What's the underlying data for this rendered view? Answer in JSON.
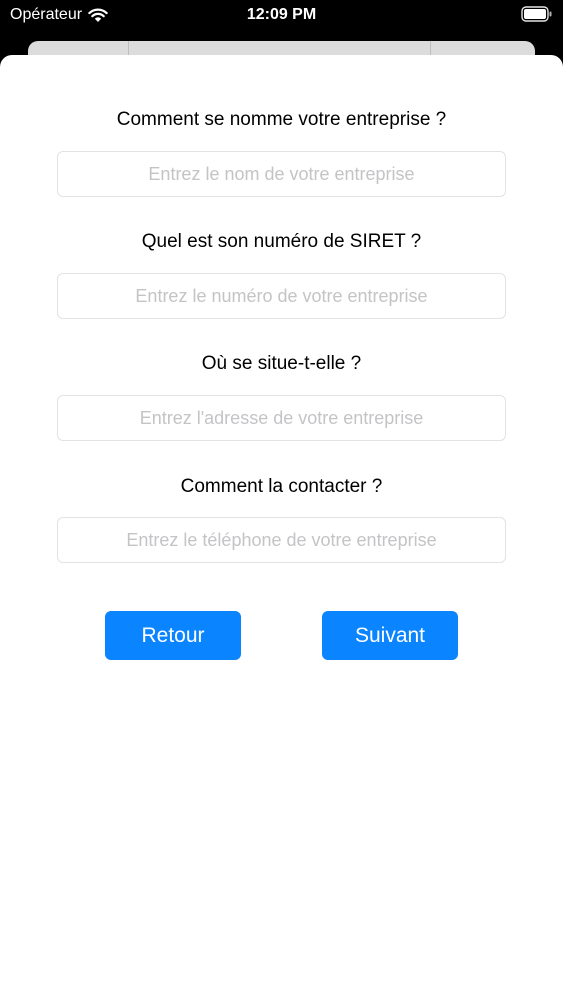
{
  "status_bar": {
    "carrier": "Opérateur",
    "time": "12:09 PM",
    "icons": [
      "wifi-icon",
      "battery-icon"
    ]
  },
  "form": {
    "questions": [
      {
        "label": "Comment se nomme votre entreprise ?",
        "placeholder": "Entrez le nom de votre entreprise",
        "value": ""
      },
      {
        "label": "Quel est son numéro de SIRET ?",
        "placeholder": "Entrez le numéro de votre entreprise",
        "value": ""
      },
      {
        "label": "Où se situe-t-elle ?",
        "placeholder": "Entrez l'adresse de votre entreprise",
        "value": ""
      },
      {
        "label": "Comment la contacter ?",
        "placeholder": "Entrez le téléphone de votre entreprise",
        "value": ""
      }
    ]
  },
  "buttons": {
    "back_label": "Retour",
    "next_label": "Suivant"
  },
  "colors": {
    "accent": "#0a84ff",
    "placeholder": "#c4c4c7",
    "field_border": "#e3e3e3"
  }
}
